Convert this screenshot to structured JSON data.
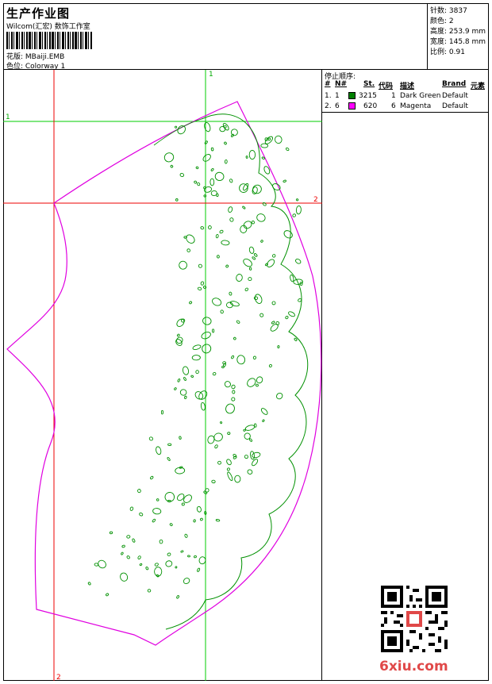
{
  "header": {
    "title": "生产作业图",
    "company": "Wilcom(汇宏) 数饰工作室",
    "design_label": "花版: MBaiji.EMB",
    "colorway_label": "色位: Colorway 1"
  },
  "stats": {
    "stitches": "针数: 3837",
    "colors": "颜色: 2",
    "height": "高度: 253.9 mm",
    "width": "宽度: 145.8 mm",
    "scale": "比例: 0.91"
  },
  "stop_sequence": {
    "label": "停止顺序:",
    "columns": [
      "#",
      "N#",
      "St.",
      "代码",
      "描述",
      "Brand",
      "元素"
    ],
    "rows": [
      {
        "index": "1.",
        "needle": "1",
        "color": "#008000",
        "stitches": "3215",
        "code": "1",
        "description": "Dark Green",
        "brand": "Default"
      },
      {
        "index": "2.",
        "needle": "6",
        "color": "#ff00ff",
        "stitches": "620",
        "code": "6",
        "description": "Magenta",
        "brand": "Default"
      }
    ]
  },
  "guides": {
    "vertical_green_label": "1",
    "horizontal_green_label": "1",
    "horizontal_red_label": "2",
    "vertical_red_label": "2"
  },
  "colors": {
    "green_guide": "#00cc00",
    "red_guide": "#ee0000",
    "outline": "#e000e0",
    "embroidery": "#009000"
  },
  "watermark": {
    "text": "6xiu.com"
  }
}
